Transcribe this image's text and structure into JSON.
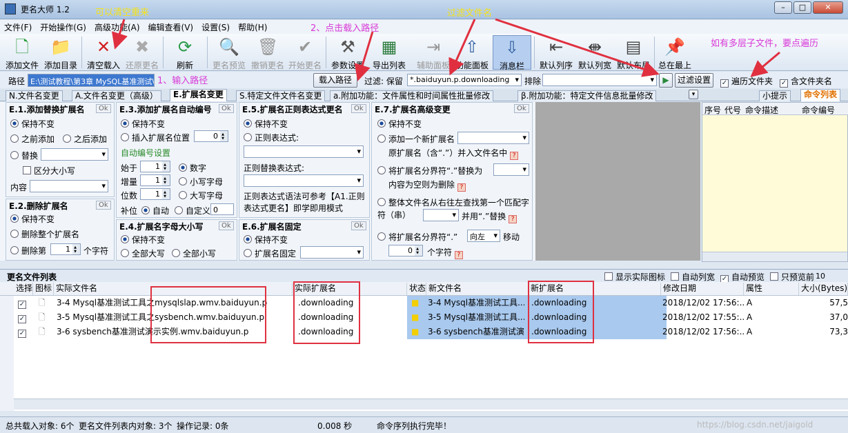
{
  "window": {
    "title": "更名大师 1.2"
  },
  "menu": [
    "文件(F)",
    "开始操作(G)",
    "高级功能(A)",
    "编辑查看(V)",
    "设置(S)",
    "帮助(H)"
  ],
  "toolbar": {
    "add_file": "添加文件",
    "add_dir": "添加目录",
    "clear_load": "清空载入",
    "restore": "还原更名",
    "refresh": "刷新",
    "preview": "更名预览",
    "undo": "撤销更名",
    "start": "开始更名",
    "params": "参数设置",
    "export": "导出列表",
    "assist": "辅助面板",
    "func": "功能面板",
    "msgbar": "消息栏",
    "default_seq": "默认列序",
    "default_width": "默认列宽",
    "default_layout": "默认布局",
    "top": "总在最上"
  },
  "annotations": {
    "clear": "可以清空重来",
    "path": "1、输入路径",
    "load": "2、点击载入路径",
    "filter": "过滤文件名",
    "recurse": "如有多层子文件，要点遍历"
  },
  "pathbar": {
    "path_label": "路径",
    "path_value": "E:\\测试教程\\第3章 MySQL基准测试\\",
    "load_btn": "载入路径",
    "filter_label": "过滤: 保留",
    "filter_value": "*.baiduyun.p.downloading",
    "exclude_label": "排除",
    "filter_settings": "过滤设置",
    "traverse": "遍历文件夹",
    "include_folder": "含文件夹名"
  },
  "tabs": [
    "N.文件名变更",
    "A.文件名变更（高级）",
    "E.扩展名变更",
    "S.特定文件文件名变更",
    "a.附加功能：文件属性和时间属性批量修改",
    "β.附加功能：特定文件信息批量修改"
  ],
  "side": {
    "tab1": "小提示",
    "tab2": "命令列表",
    "cols": [
      "序号",
      "代号",
      "命令描述",
      "命令编号"
    ]
  },
  "e1": {
    "title": "E.1.添加替换扩展名",
    "ok": "Ok",
    "keep": "保持不变",
    "before": "之前添加",
    "after": "之后添加",
    "replace": "替换",
    "case": "区分大小写",
    "content": "内容"
  },
  "e2": {
    "title": "E.2.删除扩展名",
    "ok": "Ok",
    "keep": "保持不变",
    "delete_all": "删除整个扩展名",
    "delete_nth": "删除第",
    "nth_value": "1",
    "nth_unit": "个字符"
  },
  "e3": {
    "title": "E.3.添加扩展名自动编号",
    "ok": "Ok",
    "keep": "保持不变",
    "insert_pos": "插入扩展名位置",
    "pos_value": "0",
    "auto_title": "自动编号设置",
    "start_lbl": "始于",
    "start_val": "1",
    "inc_lbl": "增量",
    "inc_val": "1",
    "digits_lbl": "位数",
    "digits_val": "1",
    "pad_lbl": "补位",
    "num": "数字",
    "lower": "小写字母",
    "upper": "大写字母",
    "auto": "自动",
    "custom": "自定义",
    "custom_val": "0"
  },
  "e4": {
    "title": "E.4.扩展名字母大小写",
    "ok": "Ok",
    "keep": "保持不变",
    "all_upper": "全部大写",
    "all_lower": "全部小写"
  },
  "e5": {
    "title": "E.5.扩展名正则表达式更名",
    "ok": "Ok",
    "keep": "保持不变",
    "regex": "正则表达式:",
    "replace_lbl": "正则替换表达式:",
    "note": "正则表达式语法可参考【A1.正则表达式更名】即学即用模式"
  },
  "e6": {
    "title": "E.6.扩展名固定",
    "ok": "Ok",
    "keep": "保持不变",
    "fixed": "扩展名固定"
  },
  "e7": {
    "title": "E.7.扩展名高级变更",
    "ok": "Ok",
    "keep": "保持不变",
    "add_new": "添加一个新扩展名",
    "orig_merge": "原扩展名（含“.”）并入文件名中",
    "sep_replace": "将扩展名分界符“.”替换为",
    "empty_delete": "内容为空则为删除",
    "search": "整体文件名从右往左查找第一个匹配字符（串）",
    "and_replace": "并用“.”替换",
    "move_sep": "将扩展名分界符“.”",
    "dir": "向左",
    "move": "移动",
    "move_val": "0",
    "char_unit": "个字符"
  },
  "list": {
    "title": "更名文件列表",
    "show_icon": "显示实际图标",
    "auto_width": "自动列宽",
    "auto_preview": "自动预览",
    "preview_only": "只预览前",
    "preview_n": "10",
    "cols": [
      "选择",
      "图标",
      "实际文件名",
      "实际扩展名",
      "状态",
      "新文件名",
      "新扩展名",
      "修改日期",
      "属性",
      "大小(Bytes)"
    ],
    "rows": [
      {
        "name": "3-4 Mysql基准测试工具之mysqlslap.wmv.baiduyun.p",
        "ext": ".downloading",
        "newname": "3-4 Mysql基准测试工具...",
        "newext": ".downloading",
        "date": "2018/12/02 17:56:...",
        "attr": "A",
        "size": "57,5"
      },
      {
        "name": "3-5 Mysql基准测试工具之sysbench.wmv.baiduyun.p",
        "ext": ".downloading",
        "newname": "3-5 Mysql基准测试工具...",
        "newext": ".downloading",
        "date": "2018/12/02 17:55:...",
        "attr": "A",
        "size": "37,0"
      },
      {
        "name": "3-6 sysbench基准测试演示实例.wmv.baiduyun.p",
        "ext": ".downloading",
        "newname": "3-6 sysbench基准测试演...",
        "newext": ".downloading",
        "date": "2018/12/02 17:56:...",
        "attr": "A",
        "size": "73,3"
      }
    ]
  },
  "status": {
    "total": "总共载入对象: 6个",
    "in_list": "更名文件列表内对象: 3个",
    "log": "操作记录: 0条",
    "time": "0.008 秒",
    "msg": "命令序列执行完毕！",
    "watermark": "https://blog.csdn.net/jaigold"
  },
  "colors": {
    "annotation_yellow": "#f5e21a",
    "annotation_magenta": "#d838d8",
    "arrow_red": "#e03040"
  }
}
